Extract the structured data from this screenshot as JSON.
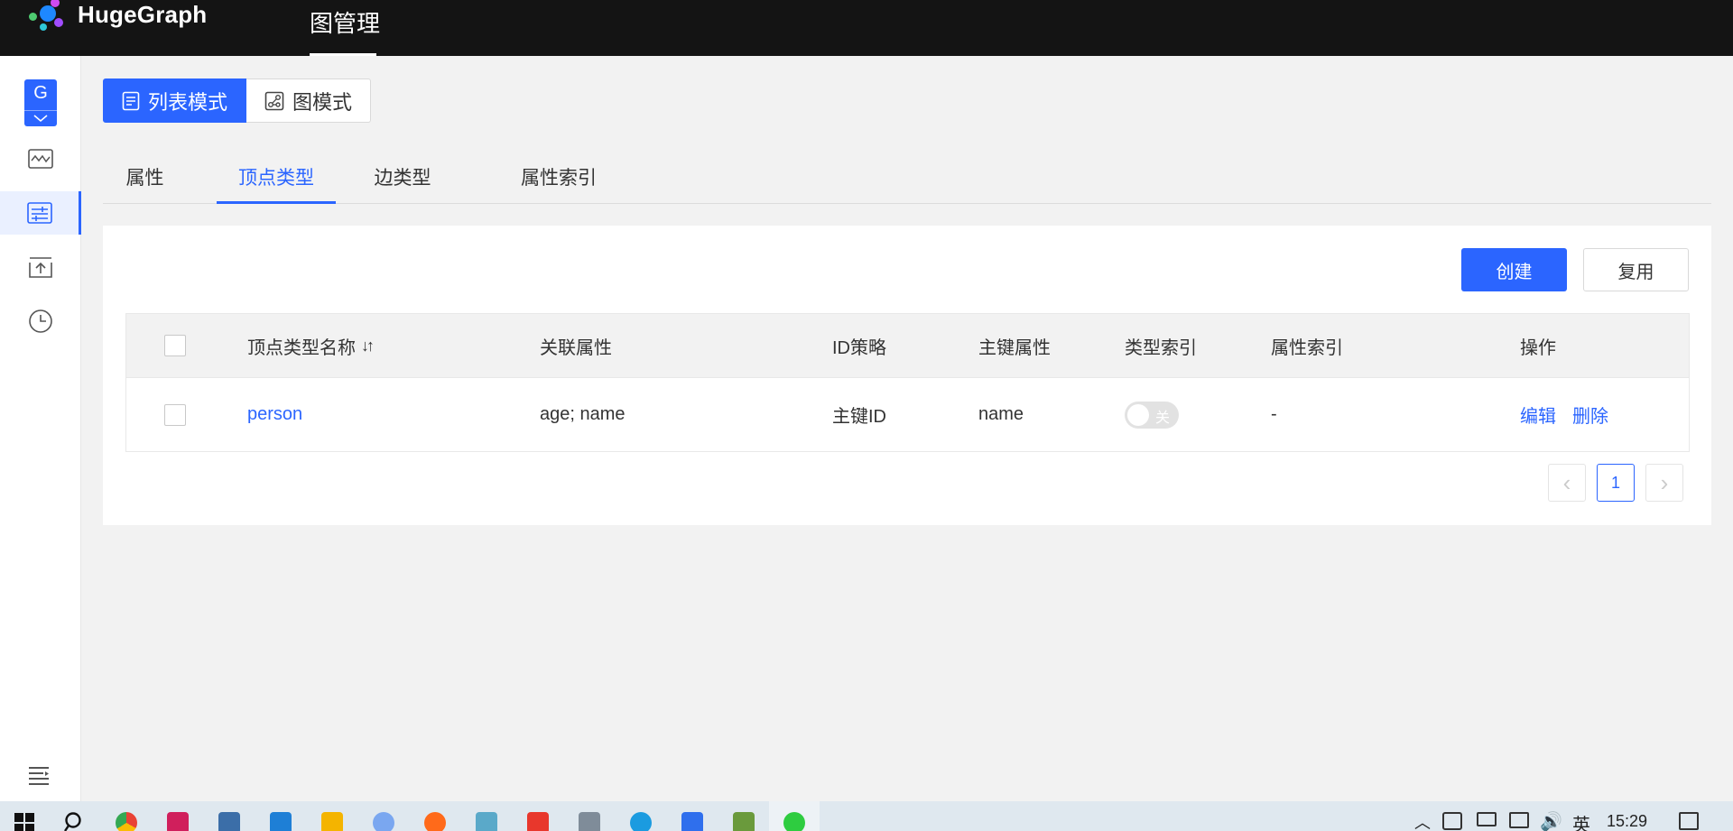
{
  "app": {
    "logo_text": "HugeGraph",
    "nav_title": "图管理"
  },
  "sidebar": {
    "graph_badge": "G",
    "items": [
      {
        "name": "graph-analysis",
        "icon": "waveform-icon",
        "active": false
      },
      {
        "name": "metadata-config",
        "icon": "sliders-list-icon",
        "active": true
      },
      {
        "name": "data-import",
        "icon": "upload-icon",
        "active": false
      },
      {
        "name": "async-tasks",
        "icon": "clock-icon",
        "active": false
      }
    ],
    "menu_icon": "hamburger-menu-icon"
  },
  "mode_switch": {
    "list_mode": "列表模式",
    "graph_mode": "图模式",
    "active": "list_mode"
  },
  "tabs": {
    "items": [
      "属性",
      "顶点类型",
      "边类型",
      "属性索引"
    ],
    "active_index": 1
  },
  "toolbar": {
    "create_label": "创建",
    "reuse_label": "复用"
  },
  "table": {
    "headers": {
      "name": "顶点类型名称",
      "sort_icon": "↓↑",
      "props": "关联属性",
      "id_strategy": "ID策略",
      "primary_keys": "主键属性",
      "type_index": "类型索引",
      "prop_index": "属性索引",
      "actions": "操作"
    },
    "rows": [
      {
        "name": "person",
        "props": "age; name",
        "id_strategy": "主键ID",
        "primary_keys": "name",
        "type_index_label": "关",
        "type_index_on": false,
        "prop_index": "-",
        "edit_label": "编辑",
        "delete_label": "删除"
      }
    ]
  },
  "pagination": {
    "prev_icon": "‹",
    "current_page": "1",
    "next_icon": "›"
  },
  "taskbar": {
    "ime_label": "英",
    "clock": "15:29"
  },
  "colors": {
    "primary": "#2b65ff",
    "topbar": "#141414",
    "background": "#f2f2f2"
  }
}
